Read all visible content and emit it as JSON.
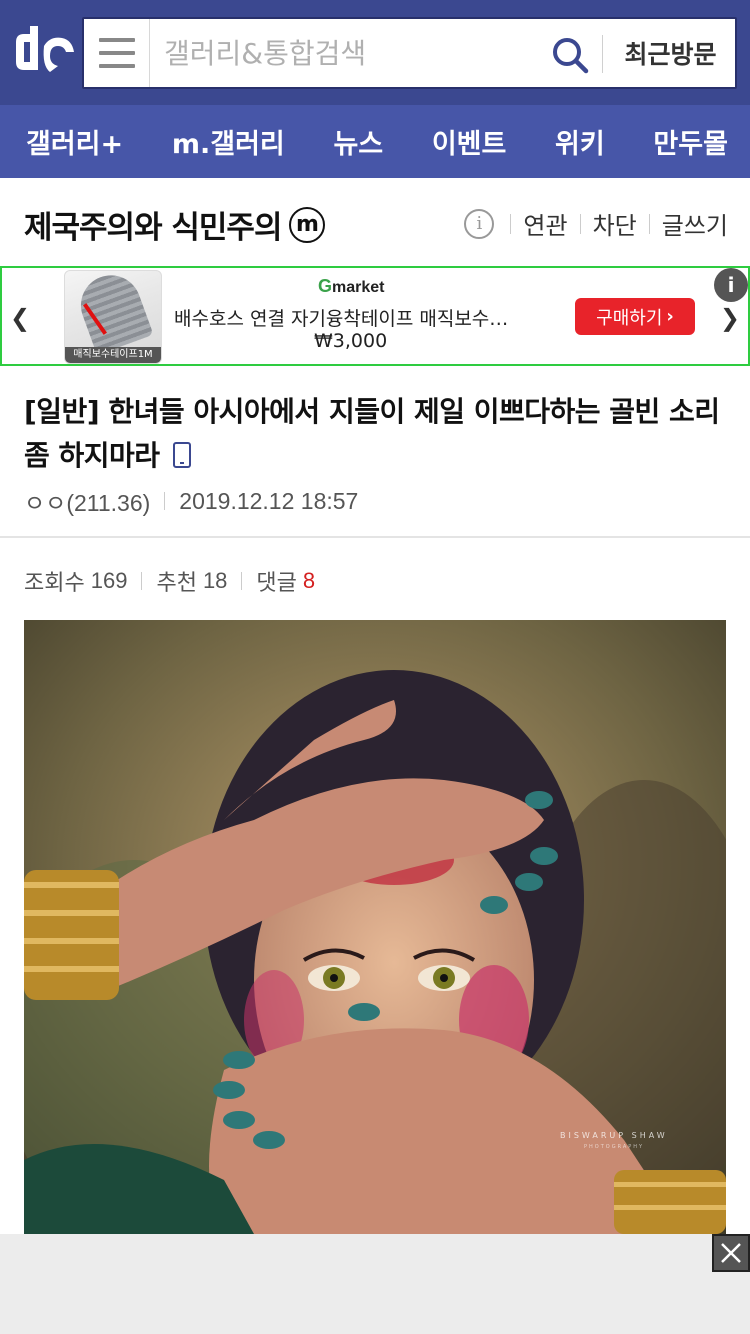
{
  "header": {
    "search_placeholder": "갤러리&통합검색",
    "recent_label": "최근방문"
  },
  "nav": [
    "갤러리+",
    "m.갤러리",
    "뉴스",
    "이벤트",
    "위키",
    "만두몰"
  ],
  "gallery": {
    "title": "제국주의와 식민주의",
    "badge": "m",
    "actions": [
      "연관",
      "차단",
      "글쓰기"
    ]
  },
  "ad": {
    "brand": "Gmarket",
    "product": "배수호스 연결 자기융착테이프 매직보수테이프",
    "price": "₩3,000",
    "buy_label": "구매하기",
    "thumb_label": "매직보수테이프1M",
    "info": "i"
  },
  "post": {
    "title": "[일반] 한녀들 아시아에서 지들이 제일 이쁘다하는 골빈 소리 좀 하지마라",
    "author": "ㅇㅇ(211.36)",
    "date": "2019.12.12 18:57",
    "views_label": "조회수",
    "views": "169",
    "recommend_label": "추천",
    "recommend": "18",
    "comments_label": "댓글",
    "comments": "8"
  },
  "photo": {
    "watermark": "BISWARUP SHAW",
    "watermark_sub": "PHOTOGRAPHY"
  },
  "colors": {
    "header_bg": "#3b4890",
    "nav_bg": "#4756a8",
    "ad_border": "#2ecc40",
    "buy_button": "#e8232a",
    "comment_count": "#d42020"
  }
}
